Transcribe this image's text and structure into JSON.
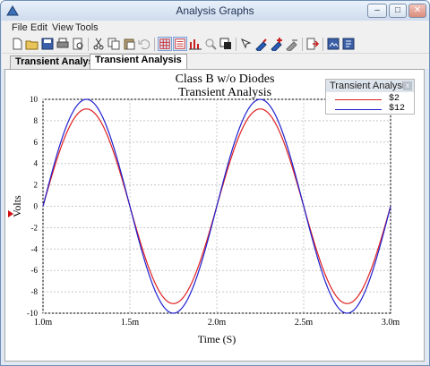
{
  "window": {
    "title": "Analysis Graphs",
    "minimize": "‒",
    "maximize": "□",
    "close": "✕"
  },
  "menu": [
    "File",
    "Edit",
    "View",
    "Tools"
  ],
  "toolbar": {
    "icons": [
      "new-icon",
      "open-icon",
      "save-icon",
      "print-icon",
      "print-preview-icon",
      "cut-icon",
      "copy-icon",
      "paste-icon",
      "undo-icon",
      "grid-icon",
      "table-icon",
      "bar-graph-icon",
      "zoom-icon",
      "window-icon",
      "cursor-icon",
      "probe-icon",
      "probe-add-icon",
      "probe-remove-icon",
      "export-icon",
      "export-image-icon",
      "properties-icon"
    ]
  },
  "tabs": [
    {
      "label": "Transient Analysis",
      "active": false
    },
    {
      "label": "Transient Analysis",
      "active": true
    }
  ],
  "legend": {
    "title": "Transient Analysis",
    "close": "x",
    "entries": [
      {
        "label": "$2",
        "color": "#e02020"
      },
      {
        "label": "$12",
        "color": "#2020d0"
      }
    ]
  },
  "chart_data": {
    "type": "line",
    "title": "Class B w/o Diodes",
    "subtitle": "Transient Analysis",
    "xlabel": "Time (S)",
    "ylabel": "Volts",
    "xlim": [
      1.0,
      3.0
    ],
    "ylim": [
      -10,
      10
    ],
    "x_unit": "ms",
    "x_ticks": [
      "1.0m",
      "1.5m",
      "2.0m",
      "2.5m",
      "3.0m"
    ],
    "y_ticks": [
      "10",
      "8",
      "6",
      "4",
      "2",
      "0",
      "-2",
      "-4",
      "-6",
      "-8",
      "-10"
    ],
    "grid": true,
    "series": [
      {
        "name": "$2",
        "color": "#e02020",
        "x": [
          1.0,
          1.05,
          1.1,
          1.15,
          1.2,
          1.25,
          1.3,
          1.35,
          1.4,
          1.45,
          1.5,
          1.55,
          1.6,
          1.65,
          1.7,
          1.75,
          1.8,
          1.85,
          1.9,
          1.95,
          2.0,
          2.05,
          2.1,
          2.15,
          2.2,
          2.25,
          2.3,
          2.35,
          2.4,
          2.45,
          2.5,
          2.55,
          2.6,
          2.65,
          2.7,
          2.75,
          2.8,
          2.85,
          2.9,
          2.95,
          3.0
        ],
        "y": [
          0,
          2.3,
          4.9,
          7.1,
          8.6,
          9.1,
          8.6,
          7.1,
          4.9,
          2.3,
          0,
          -2.3,
          -4.9,
          -7.1,
          -8.6,
          -9.1,
          -8.6,
          -7.1,
          -4.9,
          -2.3,
          0,
          2.3,
          4.9,
          7.1,
          8.6,
          9.1,
          8.6,
          7.1,
          4.9,
          2.3,
          0,
          -2.3,
          -4.9,
          -7.1,
          -8.6,
          -9.1,
          -8.6,
          -7.1,
          -4.9,
          -2.3,
          0
        ]
      },
      {
        "name": "$12",
        "color": "#2020d0",
        "x": [
          1.0,
          1.05,
          1.1,
          1.15,
          1.2,
          1.25,
          1.3,
          1.35,
          1.4,
          1.45,
          1.5,
          1.55,
          1.6,
          1.65,
          1.7,
          1.75,
          1.8,
          1.85,
          1.9,
          1.95,
          2.0,
          2.05,
          2.1,
          2.15,
          2.2,
          2.25,
          2.3,
          2.35,
          2.4,
          2.45,
          2.5,
          2.55,
          2.6,
          2.65,
          2.7,
          2.75,
          2.8,
          2.85,
          2.9,
          2.95,
          3.0
        ],
        "y": [
          0,
          3.1,
          5.9,
          8.1,
          9.5,
          10.0,
          9.5,
          8.1,
          5.9,
          3.1,
          0,
          -3.1,
          -5.9,
          -8.1,
          -9.5,
          -10.0,
          -9.5,
          -8.1,
          -5.9,
          -3.1,
          0,
          3.1,
          5.9,
          8.1,
          9.5,
          10.0,
          9.5,
          8.1,
          5.9,
          3.1,
          0,
          -3.1,
          -5.9,
          -8.1,
          -9.5,
          -10.0,
          -9.5,
          -8.1,
          -5.9,
          -3.1,
          0
        ]
      }
    ]
  }
}
